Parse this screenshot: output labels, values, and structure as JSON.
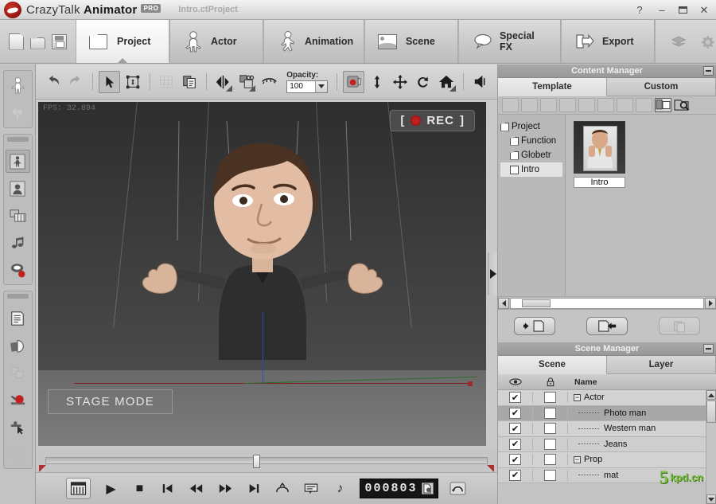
{
  "titlebar": {
    "app_name_light": "CrazyTalk ",
    "app_name_bold": "Animator",
    "pro_badge": "PRO",
    "document": "Intro.ctProject",
    "help": "?",
    "minimize": "–",
    "close": "✕"
  },
  "file_actions": [
    {
      "name": "new-project",
      "label": "New"
    },
    {
      "name": "open-project",
      "label": "Open"
    },
    {
      "name": "save-project",
      "label": "Save"
    }
  ],
  "tabs": [
    {
      "label": "Project",
      "icon": "folder-icon",
      "active": true
    },
    {
      "label": "Actor",
      "icon": "person-icon",
      "active": false
    },
    {
      "label": "Animation",
      "icon": "running-person-icon",
      "active": false
    },
    {
      "label": "Scene",
      "icon": "landscape-icon",
      "active": false
    },
    {
      "label": "Special FX",
      "icon": "speech-bubble-icon",
      "active": false
    },
    {
      "label": "Export",
      "icon": "export-arrow-icon",
      "active": false
    }
  ],
  "tab_end_icons": [
    {
      "name": "render-icon"
    },
    {
      "name": "gear-icon"
    }
  ],
  "left_toolbar": {
    "groups": [
      {
        "name": "stage-group",
        "items": [
          {
            "name": "actor-stage-icon",
            "enabled": true
          },
          {
            "name": "scene-prop-icon",
            "enabled": false
          }
        ]
      },
      {
        "name": "composer-group",
        "items": [
          {
            "name": "body-puppet-icon",
            "enabled": true
          },
          {
            "name": "face-puppet-icon",
            "enabled": true
          },
          {
            "name": "timeline-icon",
            "enabled": true
          },
          {
            "name": "audio-note-icon",
            "enabled": true
          },
          {
            "name": "lipsync-record-icon",
            "enabled": true
          }
        ]
      },
      {
        "name": "tools-group",
        "items": [
          {
            "name": "script-document-icon",
            "enabled": true
          },
          {
            "name": "flip-object-icon",
            "enabled": true
          },
          {
            "name": "duplicate-icon",
            "enabled": false
          },
          {
            "name": "motion-record-icon",
            "enabled": true
          },
          {
            "name": "pick-point-icon",
            "enabled": true
          },
          {
            "name": "text-tool-icon",
            "enabled": false
          }
        ]
      }
    ]
  },
  "toolbar2": {
    "buttons": [
      {
        "name": "undo-button",
        "icon": "undo-arrow-icon",
        "enabled": true,
        "selected": false
      },
      {
        "name": "redo-button",
        "icon": "redo-arrow-icon",
        "enabled": false,
        "selected": false
      },
      {
        "name": "select-tool",
        "icon": "cursor-arrow-icon",
        "enabled": true,
        "selected": true
      },
      {
        "name": "transform-tool",
        "icon": "transform-box-icon",
        "enabled": true,
        "selected": false
      },
      {
        "name": "mesh-tool",
        "icon": "mesh-grid-icon",
        "enabled": false,
        "selected": false
      },
      {
        "name": "copy-tool",
        "icon": "copy-pages-icon",
        "enabled": true,
        "selected": false
      },
      {
        "name": "mirror-tool",
        "icon": "mirror-flip-icon",
        "enabled": true,
        "selected": false
      },
      {
        "name": "arrange-tool",
        "icon": "arrange-layers-icon",
        "enabled": true,
        "selected": false
      },
      {
        "name": "blink-tool",
        "icon": "eyelash-icon",
        "enabled": true,
        "selected": false
      }
    ],
    "opacity_label": "Opacity:",
    "opacity_value": "100",
    "right_buttons": [
      {
        "name": "render-preview-button",
        "icon": "camera-record-icon",
        "selected": true
      },
      {
        "name": "vertical-align-button",
        "icon": "up-down-arrow-icon"
      },
      {
        "name": "move-button",
        "icon": "four-way-move-icon"
      },
      {
        "name": "rotate-button",
        "icon": "rotate-ccw-icon"
      },
      {
        "name": "home-view-button",
        "icon": "home-icon"
      },
      {
        "name": "speaker-button",
        "icon": "speaker-icon"
      }
    ]
  },
  "viewport": {
    "fps_label": "FPS: 32.894",
    "rec_label": "REC",
    "rec_bracket_left": "[",
    "rec_bracket_right": "]",
    "stage_mode": "STAGE MODE"
  },
  "transport": {
    "buttons": [
      {
        "name": "timeline-toggle-button",
        "icon": "timeline-panel-icon",
        "framed": true
      },
      {
        "name": "play-button",
        "icon": "play-icon",
        "glyph": "▶"
      },
      {
        "name": "stop-button",
        "icon": "stop-icon",
        "glyph": "■"
      },
      {
        "name": "first-frame-button",
        "icon": "skip-start-icon",
        "glyph": "⏮"
      },
      {
        "name": "rewind-button",
        "icon": "rewind-icon",
        "glyph": "◀◀"
      },
      {
        "name": "forward-button",
        "icon": "fast-forward-icon",
        "glyph": "▶▶"
      },
      {
        "name": "last-frame-button",
        "icon": "skip-end-icon",
        "glyph": "⏭"
      },
      {
        "name": "loop-range-button",
        "icon": "loop-range-icon",
        "glyph": "⌒"
      },
      {
        "name": "subtitle-button",
        "icon": "subtitle-icon",
        "glyph": "⌨"
      },
      {
        "name": "audio-button",
        "icon": "music-note-icon",
        "glyph": "♪"
      }
    ],
    "timecode": "000803",
    "timecode_btn": "frame-settings-icon",
    "loop_button": "loop-playback-icon"
  },
  "content_manager": {
    "title": "Content Manager",
    "minimize": "minimize-panel-icon",
    "tabs": [
      {
        "label": "Template",
        "active": true
      },
      {
        "label": "Custom",
        "active": false
      }
    ],
    "toolbar_icons": [
      {
        "name": "open-folder-icon",
        "enabled": false
      },
      {
        "name": "add-item-icon",
        "enabled": false
      },
      {
        "name": "copy-item-icon",
        "enabled": false
      },
      {
        "name": "paste-item-icon",
        "enabled": false
      },
      {
        "name": "delete-item-icon",
        "enabled": false
      },
      {
        "name": "new-folder-icon",
        "enabled": false
      },
      {
        "name": "import-icon",
        "enabled": false
      },
      {
        "name": "export-icon",
        "enabled": false
      },
      {
        "name": "view-mode-icon",
        "enabled": true
      },
      {
        "name": "search-icon",
        "enabled": true
      }
    ],
    "tree": [
      {
        "label": "Project",
        "icon": "folder-icon",
        "indent": 0,
        "selected": false
      },
      {
        "label": "Function",
        "icon": "folder-icon",
        "indent": 1,
        "selected": false
      },
      {
        "label": "Globetr",
        "icon": "folder-icon",
        "indent": 1,
        "selected": false
      },
      {
        "label": "Intro",
        "icon": "project-file-icon",
        "indent": 1,
        "selected": true
      }
    ],
    "items": [
      {
        "label": "Intro",
        "thumbnail": "photo-man-thumbnail"
      }
    ],
    "hscroll": "horizontal-scrollbar",
    "actions": [
      {
        "name": "load-content-button",
        "icon": "arrow-into-page-icon",
        "enabled": true
      },
      {
        "name": "apply-content-button",
        "icon": "arrow-out-of-page-icon",
        "enabled": true
      },
      {
        "name": "extra-content-button",
        "icon": "pages-icon",
        "enabled": false
      }
    ]
  },
  "scene_manager": {
    "title": "Scene Manager",
    "minimize": "minimize-panel-icon",
    "tabs": [
      {
        "label": "Scene",
        "active": true
      },
      {
        "label": "Layer",
        "active": false
      }
    ],
    "columns": {
      "visibility": "eye-icon",
      "lock": "lock-icon",
      "name": "Name"
    },
    "rows": [
      {
        "name": "Actor",
        "type": "group",
        "expander": "−",
        "visible": true,
        "locked": false,
        "selected": false,
        "indent": 0
      },
      {
        "name": "Photo man",
        "type": "child",
        "visible": true,
        "locked": false,
        "selected": true,
        "indent": 1
      },
      {
        "name": "Western man",
        "type": "child",
        "visible": true,
        "locked": false,
        "selected": false,
        "indent": 1
      },
      {
        "name": "Jeans",
        "type": "child",
        "visible": true,
        "locked": false,
        "selected": false,
        "indent": 1
      },
      {
        "name": "Prop",
        "type": "group",
        "expander": "−",
        "visible": true,
        "locked": false,
        "selected": false,
        "indent": 0
      },
      {
        "name": "mat",
        "type": "child",
        "visible": true,
        "locked": false,
        "selected": false,
        "indent": 1
      }
    ],
    "checkmark": "✔"
  },
  "watermark": {
    "digit": "5",
    "text": "kpd.cn"
  },
  "colors": {
    "accent_red": "#c42020",
    "panel_bg": "#c4c4c4",
    "title_bar": "#e2e2e2",
    "viewport_bg": "#3a3a3a",
    "watermark_green": "#7ac043"
  }
}
